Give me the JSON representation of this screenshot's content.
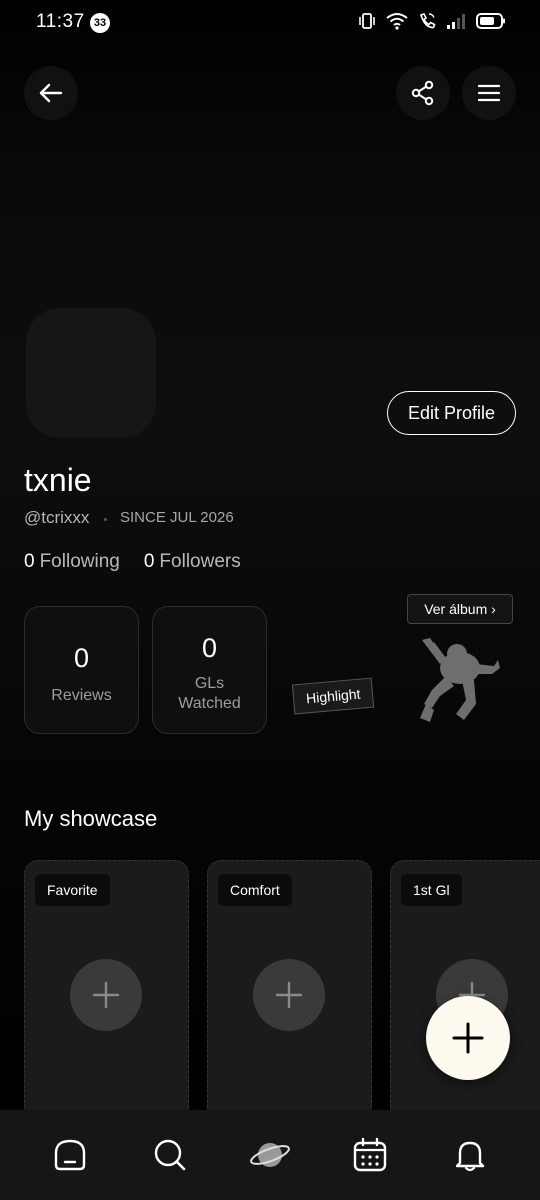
{
  "status_bar": {
    "time": "11:37",
    "notification_count": "33",
    "icons": [
      "vibrate-icon",
      "wifi-icon",
      "wifi-call-icon",
      "signal-icon",
      "battery-icon"
    ]
  },
  "header": {
    "back_icon": "arrow-left-icon",
    "share_icon": "share-icon",
    "menu_icon": "hamburger-menu-icon"
  },
  "profile": {
    "edit_label": "Edit Profile",
    "username": "txnie",
    "handle": "@tcrixxx",
    "since": "SINCE JUL 2026",
    "following_count": "0",
    "following_label": "Following",
    "followers_count": "0",
    "followers_label": "Followers"
  },
  "stats": [
    {
      "value": "0",
      "label": "Reviews"
    },
    {
      "value": "0",
      "label": "GLs Watched"
    }
  ],
  "highlight": {
    "tag": "Highlight",
    "album_label": "Ver álbum ›"
  },
  "showcase": {
    "title": "My showcase",
    "cards": [
      {
        "tag": "Favorite"
      },
      {
        "tag": "Comfort"
      },
      {
        "tag": "1st Gl"
      }
    ]
  },
  "fab_icon": "plus-icon",
  "bottom_nav": [
    {
      "icon": "home-icon"
    },
    {
      "icon": "search-icon"
    },
    {
      "icon": "planet-icon"
    },
    {
      "icon": "calendar-icon"
    },
    {
      "icon": "bell-icon"
    }
  ],
  "colors": {
    "background": "#000000",
    "card": "#1b1b1b",
    "fab": "#fffaf0",
    "nav": "#161616"
  }
}
